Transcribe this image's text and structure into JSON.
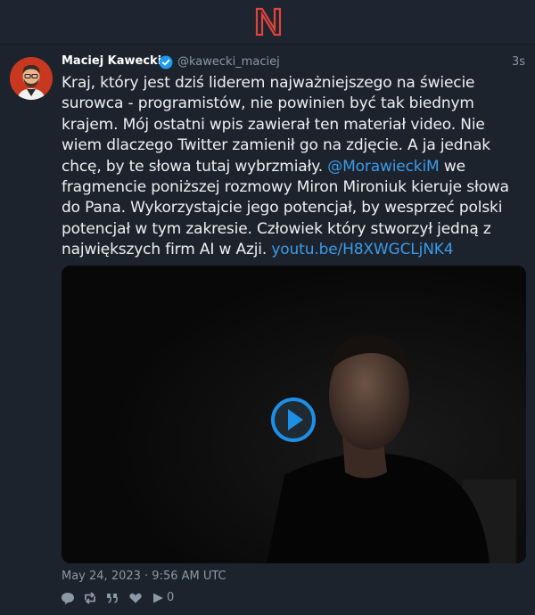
{
  "tweet": {
    "author_name": "Maciej Kawecki",
    "handle": "@kawecki_maciej",
    "time": "3s",
    "text_part1": "Kraj, który jest dziś liderem najważniejszego na świecie surowca - programistów, nie powinien być tak biednym krajem. Mój ostatni wpis zawierał ten materiał video. Nie wiem dlaczego Twitter zamienił go na zdjęcie. A ja jednak chcę, by te słowa tutaj wybrzmiały. ",
    "mention": "@MorawieckiM",
    "text_part2": " we fragmencie poniższej rozmowy Miron Mironiuk kieruje słowa do Pana. Wykorzystajcie jego potencjał, by wesprzeć polski potencjał w tym zakresie. Człowiek który stworzył jedną z największych firm AI w Azji. ",
    "link": "youtu.be/H8XWGCLjNK4",
    "date": "May 24, 2023 · 9:56 AM UTC",
    "play_count": "0"
  },
  "colors": {
    "background": "#1d232d",
    "accent_link": "#3b9be8",
    "logo_red": "#e0443c",
    "muted": "#8b98a5"
  },
  "icons": {
    "logo": "nitter-logo",
    "verified": "verified-badge-icon",
    "reply": "comment-icon",
    "retweet": "retweet-icon",
    "quote": "quote-icon",
    "like": "heart-icon",
    "play": "play-icon"
  }
}
